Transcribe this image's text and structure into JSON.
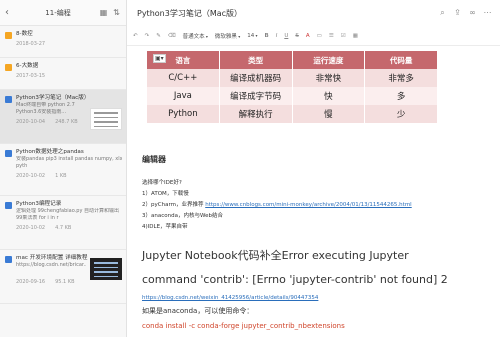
{
  "left": {
    "title": "11-编程",
    "notes": [
      {
        "kind": "folder",
        "title": "8-数控",
        "date": "2018-03-27"
      },
      {
        "kind": "folder",
        "title": "6-大数据",
        "date": "2017-03-15"
      },
      {
        "kind": "note",
        "title": "Python3学习笔记（Mac版）",
        "snippet1": "Mac终端自带 python 2.7",
        "snippet2": "Python3.6安装指南...",
        "date": "2020-10-04",
        "size": "248.7 KB",
        "selected": true
      },
      {
        "kind": "note",
        "title": "Python数据处理之pandas",
        "snippet1": "安装pandas pip3 install pandas numpy, xlx,",
        "snippet2": "pyth",
        "date": "2020-10-02",
        "size": "1 KB"
      },
      {
        "kind": "note",
        "title": "Python3编程记录",
        "snippet1": "逻辑处理 99chengfabiao.py 自动计算和输出",
        "snippet2": "99乘法表 for i in r",
        "date": "2020-10-02",
        "size": "4.7 KB"
      },
      {
        "kind": "note",
        "title": "mac 开发环境配置 详细教程",
        "snippet1": "https://blog.csdn.net/bricar...",
        "snippet2": "",
        "date": "2020-09-16",
        "size": "95.1 KB"
      }
    ]
  },
  "doc": {
    "title": "Python3学习笔记（Mac版）",
    "toolbar": {
      "style": "普通文本",
      "font": "微软雅黑",
      "size": "14",
      "bold": "B",
      "italic": "I",
      "underline": "U",
      "strike": "S",
      "color": "A"
    },
    "table": {
      "headers": [
        "语言",
        "类型",
        "运行速度",
        "代码量"
      ],
      "rows": [
        [
          "C/C++",
          "编译成机器码",
          "非常快",
          "非常多"
        ],
        [
          "Java",
          "编译成字节码",
          "快",
          "多"
        ],
        [
          "Python",
          "解释执行",
          "慢",
          "少"
        ]
      ]
    },
    "section_heading": "编辑器",
    "intro": "选择哪个IDE好?",
    "ide_items": [
      {
        "prefix": "1）ATOM，下载慢",
        "link": ""
      },
      {
        "prefix": "2）pyCharm，业界推荐 ",
        "link": "https://www.cnblogs.com/mini-monkey/archive/2004/01/13/11544265.html"
      },
      {
        "prefix": "3）anaconda，内核与Web结合",
        "link": ""
      },
      {
        "prefix": "4)IDLE，苹果自带",
        "link": ""
      }
    ],
    "big_error_line1": "Jupyter Notebook代码补全Error executing Jupyter",
    "big_error_line2": "command 'contrib': [Errno 'jupyter-contrib' not found] 2",
    "ref_link": "https://blog.csdn.net/weixin_41425956/article/details/90447354",
    "anaconda_note": "如果是anaconda，可以使用命令：",
    "command": "conda install -c conda-forge jupyter_contrib_nbextensions"
  },
  "colors": {
    "table_header": "#c5686d",
    "table_row": "#f4dede",
    "link": "#2a6ebb",
    "command": "#d0452b",
    "folder_icon": "#f5a623",
    "note_icon": "#3a7bd5"
  },
  "icons": {
    "left_header": [
      "back-arrow-icon",
      "layout-icon",
      "sort-icon"
    ],
    "doc_header": [
      "search-icon",
      "share-icon",
      "link-icon",
      "more-icon"
    ]
  }
}
